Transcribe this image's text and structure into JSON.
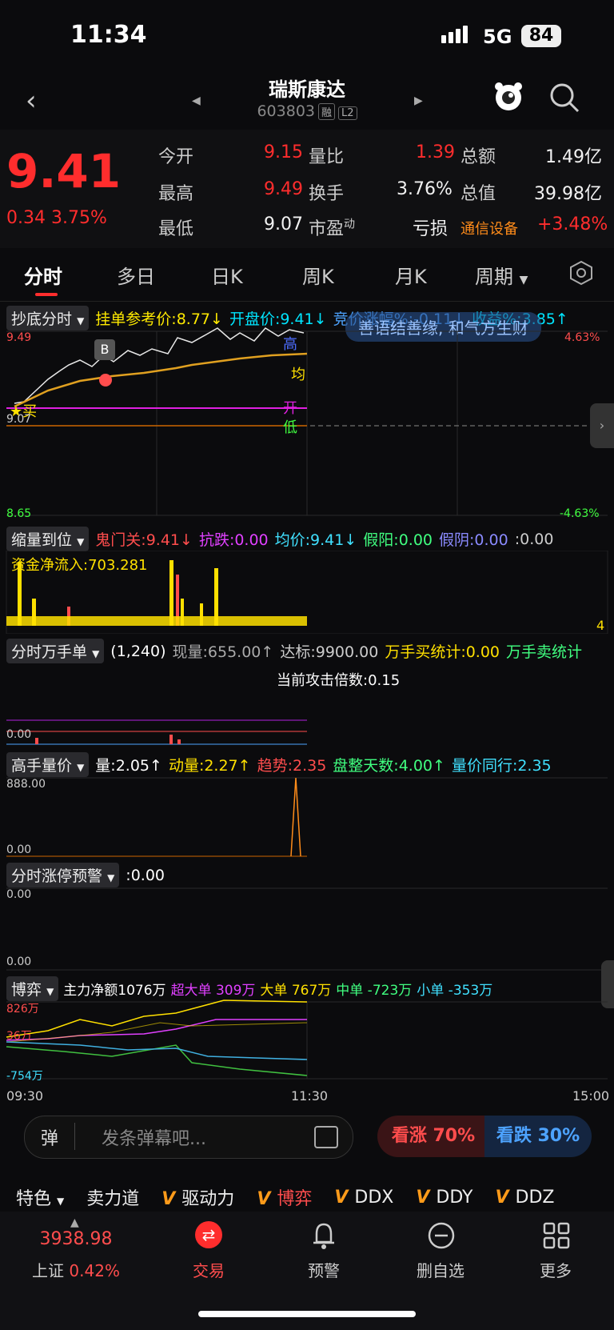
{
  "status": {
    "time": "11:34",
    "network": "5G",
    "battery": "84"
  },
  "header": {
    "name": "瑞斯康达",
    "code": "603803",
    "tag1": "融",
    "tag2": "L2"
  },
  "quote": {
    "price": "9.41",
    "change": "0.34",
    "change_pct": "3.75%",
    "open_label": "今开",
    "open": "9.15",
    "high_label": "最高",
    "high": "9.49",
    "low_label": "最低",
    "low": "9.07",
    "vr_label": "量比",
    "vr": "1.39",
    "turnover_label": "换手",
    "turnover": "3.76%",
    "pe_label": "市盈",
    "pe_sup": "动",
    "pe": "亏损",
    "amount_label": "总额",
    "amount": "1.49亿",
    "mcap_label": "总值",
    "mcap": "39.98亿",
    "sector": "通信设备",
    "sector_pct": "+3.48%"
  },
  "tabs": [
    "分时",
    "多日",
    "日K",
    "周K",
    "月K",
    "周期"
  ],
  "panel1": {
    "name": "抄底分时",
    "i1": "挂单参考价:8.77↓",
    "i2": "开盘价:9.41↓",
    "i3": "竞价涨幅%:-0.11↓",
    "i4": "收益%:3.85↑",
    "banner": "善语结善缘, 和气方生财",
    "y_top": "9.49",
    "y_mid": "9.07",
    "y_bot": "8.65",
    "pct_top": "4.63%",
    "pct_bot": "-4.63%",
    "lab_high": "高",
    "lab_avg": "均",
    "lab_open": "开",
    "lab_low": "低",
    "buy": "买",
    "bmark": "B"
  },
  "panel2": {
    "name": "缩量到位",
    "i1": "鬼门关:9.41↓",
    "i2": "抗跌:0.00",
    "i3": "均价:9.41↓",
    "i4": "假阳:0.00",
    "i5": "假阴:0.00",
    "i6": ":0.00",
    "fund": "资金净流入:703.281",
    "right": "4"
  },
  "panel3": {
    "name": "分时万手单",
    "i1": "(1,240)",
    "i2": "现量:655.00↑",
    "i3": "达标:9900.00",
    "i4": "万手买统计:0.00",
    "i5": "万手卖统计",
    "line2": "当前攻击倍数:0.15",
    "y": "0.00"
  },
  "panel4": {
    "name": "高手量价",
    "i1": "量:2.05↑",
    "i2": "动量:2.27↑",
    "i3": "趋势:2.35",
    "i4": "盘整天数:4.00↑",
    "i5": "量价同行:2.35",
    "y_top": "888.00",
    "y_bot": "0.00"
  },
  "panel5": {
    "name": "分时涨停预警",
    "i1": ":0.00",
    "y_top": "0.00",
    "y_bot": "0.00"
  },
  "panel6": {
    "name": "博弈",
    "i1": "主力净额1076万",
    "i2": "超大单 309万",
    "i3": "大单 767万",
    "i4": "中单 -723万",
    "i5": "小单 -353万",
    "y_top": "826万",
    "y_mid": "36万",
    "y_bot": "-754万",
    "x_start": "09:30",
    "x_mid": "11:30",
    "x_end": "15:00"
  },
  "bottom": {
    "danmu_icon": "弹",
    "danmu_placeholder": "发条弹幕吧...",
    "bull": "看涨 70%",
    "bear": "看跌 30%",
    "feature": "特色",
    "f1": "卖力道",
    "f2": "驱动力",
    "f3": "博弈",
    "f4": "DDX",
    "f5": "DDY",
    "f6": "DDZ"
  },
  "nav": {
    "index_value": "3938.98",
    "index_name": "上证",
    "index_pct": "0.42%",
    "trade": "交易",
    "alert": "预警",
    "remove": "删自选",
    "more": "更多"
  },
  "chart_data": {
    "type": "line",
    "x": [
      "09:30",
      "11:30",
      "15:00"
    ],
    "series": [
      {
        "name": "主力净额",
        "values": [
          0,
          1076
        ]
      },
      {
        "name": "超大单",
        "values": [
          0,
          309
        ]
      },
      {
        "name": "大单",
        "values": [
          0,
          767
        ]
      },
      {
        "name": "中单",
        "values": [
          0,
          -723
        ]
      },
      {
        "name": "小单",
        "values": [
          0,
          -353
        ]
      }
    ],
    "ylim": [
      -754,
      826
    ]
  }
}
